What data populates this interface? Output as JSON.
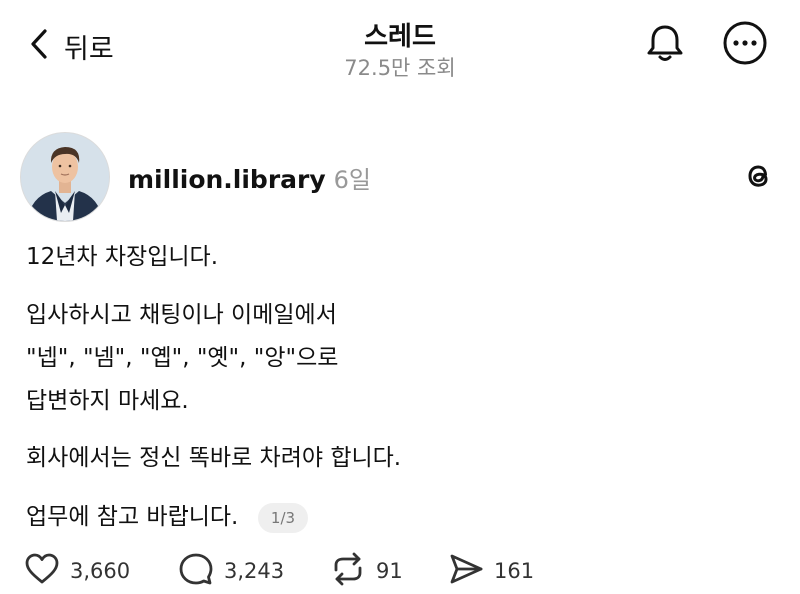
{
  "header": {
    "back_label": "뒤로",
    "title": "스레드",
    "subtitle": "72.5만 조회"
  },
  "post": {
    "username": "million.library",
    "age": "6일",
    "lines": [
      "12년차 차장입니다.",
      "입사하시고 채팅이나 이메일에서",
      "\"넵\", \"넴\", \"옙\", \"옛\", \"앙\"으로",
      "답변하지 마세요.",
      "회사에서는 정신 똑바로 차려야 합니다.",
      "업무에 참고 바랍니다."
    ],
    "page_indicator": "1/3"
  },
  "actions": {
    "likes": "3,660",
    "replies": "3,243",
    "reposts": "91",
    "shares": "161"
  },
  "icons": [
    "chevron-left-icon",
    "bell-icon",
    "more-icon",
    "threads-logo-icon",
    "heart-icon",
    "comment-icon",
    "repost-icon",
    "send-icon"
  ]
}
